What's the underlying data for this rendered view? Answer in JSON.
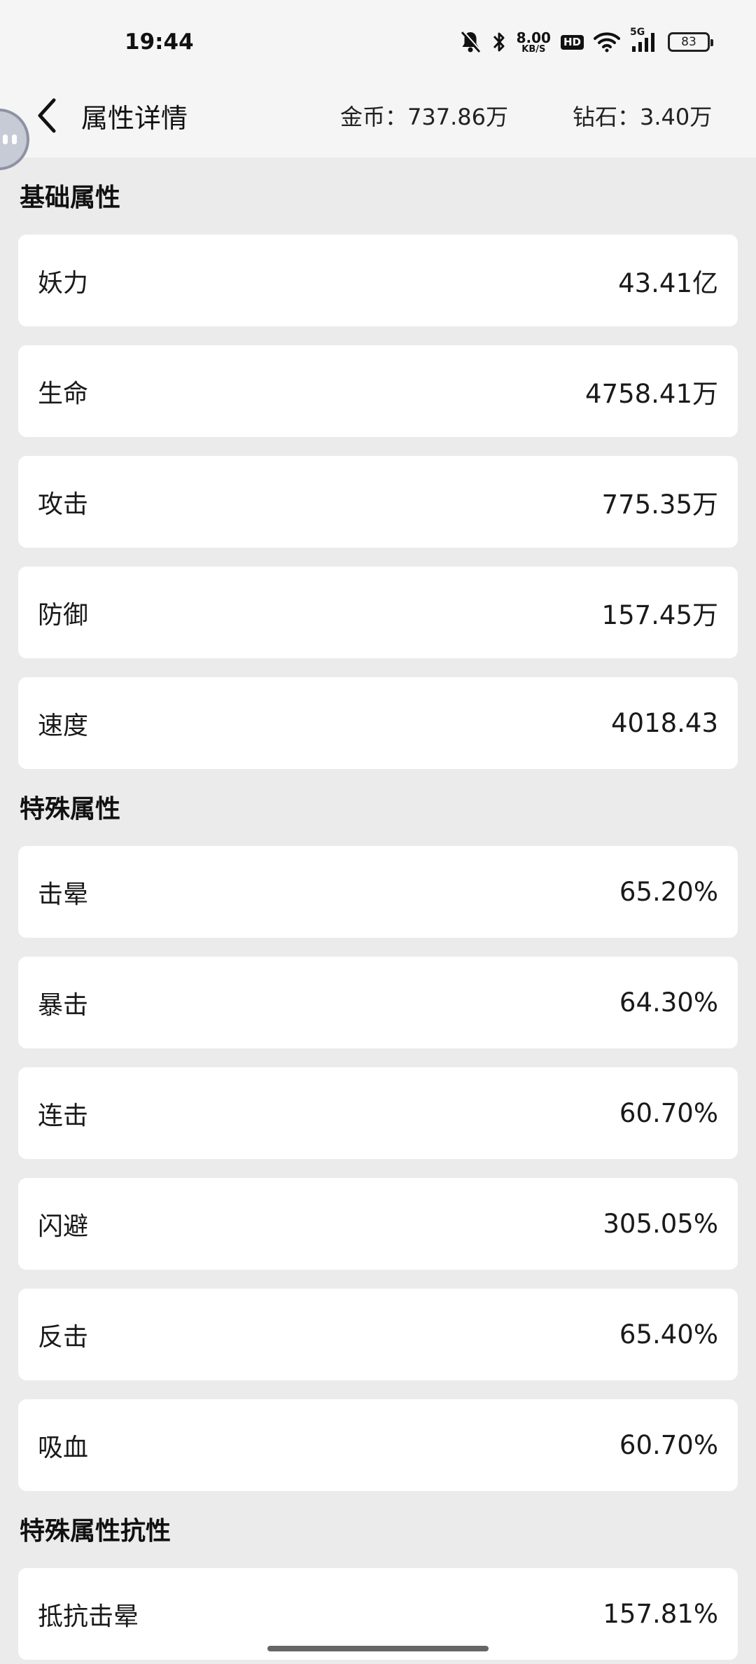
{
  "status_bar": {
    "time": "19:44",
    "net_speed_value": "8.00",
    "net_speed_unit": "KB/S",
    "hd": "HD",
    "signal": "5G",
    "battery": "83",
    "icons": [
      "bell-muted-icon",
      "bluetooth-icon",
      "wifi-icon",
      "cell-signal-icon",
      "battery-icon"
    ]
  },
  "header": {
    "title": "属性详情",
    "gold": "金币：737.86万",
    "diamond": "钻石：3.40万"
  },
  "sections": [
    {
      "title": "基础属性",
      "rows": [
        {
          "label": "妖力",
          "value": "43.41亿"
        },
        {
          "label": "生命",
          "value": "4758.41万"
        },
        {
          "label": "攻击",
          "value": "775.35万"
        },
        {
          "label": "防御",
          "value": "157.45万"
        },
        {
          "label": "速度",
          "value": "4018.43"
        }
      ]
    },
    {
      "title": "特殊属性",
      "rows": [
        {
          "label": "击晕",
          "value": "65.20%"
        },
        {
          "label": "暴击",
          "value": "64.30%"
        },
        {
          "label": "连击",
          "value": "60.70%"
        },
        {
          "label": "闪避",
          "value": "305.05%"
        },
        {
          "label": "反击",
          "value": "65.40%"
        },
        {
          "label": "吸血",
          "value": "60.70%"
        }
      ]
    },
    {
      "title": "特殊属性抗性",
      "rows": [
        {
          "label": "抵抗击晕",
          "value": "157.81%"
        }
      ]
    }
  ]
}
